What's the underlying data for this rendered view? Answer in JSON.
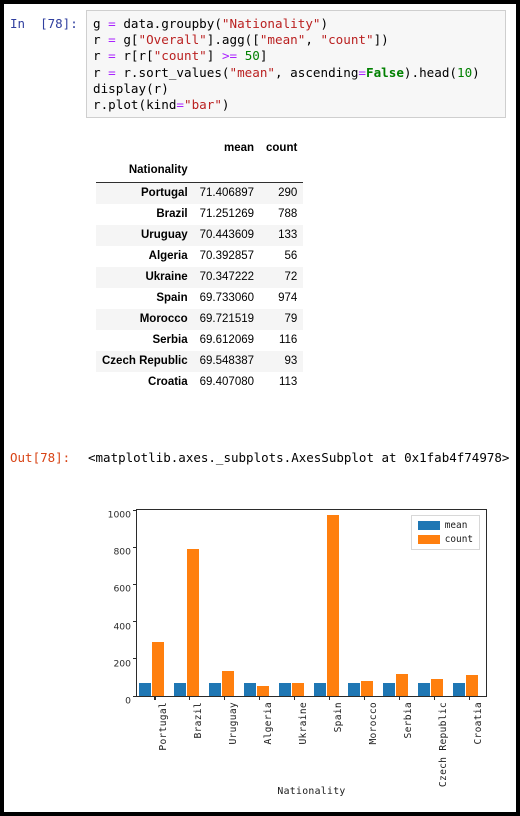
{
  "notebook": {
    "input_prompt": "In  [78]:",
    "output_prompt": "Out[78]:",
    "output_text": "<matplotlib.axes._subplots.AxesSubplot at 0x1fab4f74978>",
    "code_lines": [
      "g = data.groupby(\"Nationality\")",
      "r = g[\"Overall\"].agg([\"mean\", \"count\"])",
      "r = r[r[\"count\"] >= 50]",
      "r = r.sort_values(\"mean\", ascending=False).head(10)",
      "display(r)",
      "r.plot(kind=\"bar\")"
    ]
  },
  "table": {
    "index_name": "Nationality",
    "columns": [
      "mean",
      "count"
    ],
    "rows": [
      {
        "name": "Portugal",
        "mean": "71.406897",
        "count": "290"
      },
      {
        "name": "Brazil",
        "mean": "71.251269",
        "count": "788"
      },
      {
        "name": "Uruguay",
        "mean": "70.443609",
        "count": "133"
      },
      {
        "name": "Algeria",
        "mean": "70.392857",
        "count": "56"
      },
      {
        "name": "Ukraine",
        "mean": "70.347222",
        "count": "72"
      },
      {
        "name": "Spain",
        "mean": "69.733060",
        "count": "974"
      },
      {
        "name": "Morocco",
        "mean": "69.721519",
        "count": "79"
      },
      {
        "name": "Serbia",
        "mean": "69.612069",
        "count": "116"
      },
      {
        "name": "Czech Republic",
        "mean": "69.548387",
        "count": "93"
      },
      {
        "name": "Croatia",
        "mean": "69.407080",
        "count": "113"
      }
    ]
  },
  "chart_data": {
    "type": "bar",
    "title": "",
    "xlabel": "Nationality",
    "ylabel": "",
    "ylim": [
      0,
      1000
    ],
    "yticks": [
      0,
      200,
      400,
      600,
      800,
      1000
    ],
    "grid": false,
    "legend_position": "upper right",
    "categories": [
      "Portugal",
      "Brazil",
      "Uruguay",
      "Algeria",
      "Ukraine",
      "Spain",
      "Morocco",
      "Serbia",
      "Czech Republic",
      "Croatia"
    ],
    "series": [
      {
        "name": "mean",
        "color": "#1f77b4",
        "values": [
          71.406897,
          71.251269,
          70.443609,
          70.392857,
          70.347222,
          69.73306,
          69.721519,
          69.612069,
          69.548387,
          69.40708
        ]
      },
      {
        "name": "count",
        "color": "#ff7f0e",
        "values": [
          290,
          788,
          133,
          56,
          72,
          974,
          79,
          116,
          93,
          113
        ]
      }
    ]
  }
}
